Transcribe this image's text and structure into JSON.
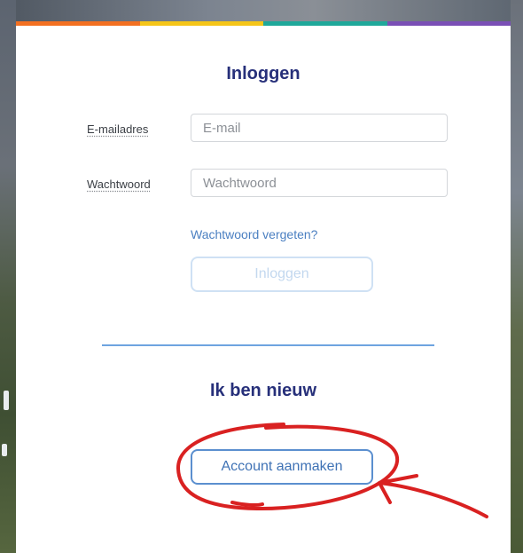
{
  "login": {
    "title": "Inloggen",
    "email_label": "E-mailadres",
    "email_placeholder": "E-mail",
    "email_value": "",
    "password_label": "Wachtwoord",
    "password_placeholder": "Wachtwoord",
    "password_value": "",
    "forgot_link": "Wachtwoord vergeten?",
    "submit_label": "Inloggen"
  },
  "register": {
    "title": "Ik ben nieuw",
    "create_account_label": "Account aanmaken"
  },
  "colors": {
    "rainbow": [
      "#f37021",
      "#f5c518",
      "#1fa89a",
      "#7a4fb5"
    ],
    "title": "#27307a",
    "link": "#4a7fc1",
    "annotation": "#d92121"
  }
}
